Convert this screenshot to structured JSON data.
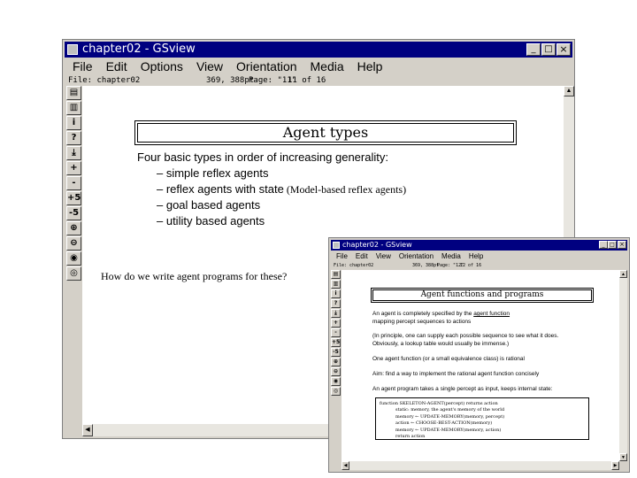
{
  "main_window": {
    "title": "chapter02 - GSview",
    "controls": {
      "minimize": "_",
      "maximize": "□",
      "close": "×"
    },
    "menu": [
      "File",
      "Edit",
      "Options",
      "View",
      "Orientation",
      "Media",
      "Help"
    ],
    "status": {
      "file": "File: chapter02",
      "coords": "369, 388pt",
      "page": "Page: \"11\"",
      "of": "11 of 16"
    },
    "toolbar": [
      "▤",
      "▥",
      "i",
      "?",
      "⤓",
      "+",
      "-",
      "+5",
      "-5",
      "⊕",
      "⊖",
      "◉",
      "◎"
    ],
    "slide": {
      "title": "Agent types",
      "lead": "Four basic types in order of increasing generality:",
      "items": [
        {
          "text": "– simple reflex agents",
          "note": ""
        },
        {
          "text": "– reflex agents with state",
          "note": " (Model-based reflex agents)"
        },
        {
          "text": "– goal based agents",
          "note": ""
        },
        {
          "text": "– utility based agents",
          "note": ""
        }
      ]
    },
    "scroll_arrows": {
      "up": "▲",
      "down": "▼",
      "left": "◀",
      "right": "▶"
    }
  },
  "question": "How do we write agent programs for these?",
  "second_window": {
    "title": "chapter02 - GSview",
    "controls": {
      "minimize": "_",
      "maximize": "□",
      "close": "×"
    },
    "menu": [
      "File",
      "Edit",
      "View",
      "Orientation",
      "Media",
      "Help"
    ],
    "status": {
      "file": "File: chapter02",
      "coords": "369, 388pt",
      "page": "Page: \"12\"",
      "of": "12 of 16"
    },
    "toolbar": [
      "▤",
      "▥",
      "i",
      "?",
      "⤓",
      "+",
      "-",
      "+5",
      "-5",
      "⊕",
      "⊖",
      "◉",
      "◎"
    ],
    "slide": {
      "title": "Agent functions and programs",
      "p1a": "An agent is completely specified by the ",
      "p1u": "agent function",
      "p1b": "mapping percept sequences to actions",
      "p2a": "(In principle, one can supply each possible sequence to see what it does.",
      "p2b": "Obviously, a lookup table would usually be immense.)",
      "p3": "One agent function (or a small equivalence class) is rational",
      "p4": "Aim: find a way to implement the rational agent function concisely",
      "p5": "An agent program takes a single percept as input, keeps internal state:",
      "code": [
        "function SKELETON-AGENT(percept) returns action",
        "static: memory, the agent's memory of the world",
        "memory ← UPDATE-MEMORY(memory, percept)",
        "action ← CHOOSE-BEST-ACTION(memory)",
        "memory ← UPDATE-MEMORY(memory, action)",
        "return action"
      ]
    },
    "scroll_arrows": {
      "up": "▲",
      "down": "▼",
      "left": "◀",
      "right": "▶"
    }
  }
}
